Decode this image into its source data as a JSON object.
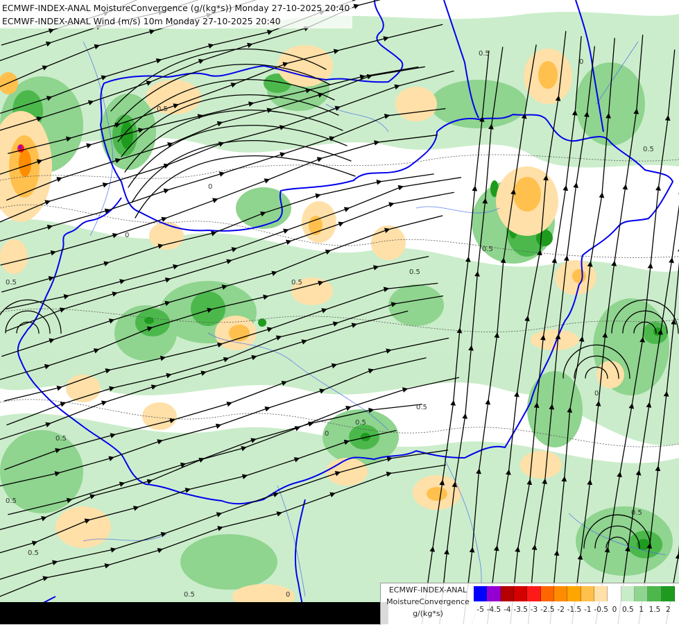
{
  "title": {
    "line1": "ECMWF-INDEX-ANAL MoistureConvergence (g/(kg*s)) Monday 27-10-2025 20:40",
    "line2": "ECMWF-INDEX-ANAL Wind (m/s) 10m Monday 27-10-2025 20:40"
  },
  "legend": {
    "line1": "ECMWF-INDEX-ANAL",
    "line2": "MoistureConvergence",
    "line3": "g/(kg*s)",
    "ticks": [
      "-5",
      "-4.5",
      "-4",
      "-3.5",
      "-3",
      "-2.5",
      "-2",
      "-1.5",
      "-1",
      "-0.5",
      "0",
      "0.5",
      "1",
      "1.5",
      "2"
    ],
    "colors": [
      "#0000ff",
      "#9400d3",
      "#b40000",
      "#d40000",
      "#ff1a1a",
      "#ff6600",
      "#ff8c00",
      "#ffa500",
      "#ffc04d",
      "#ffe0a8",
      "#ffffff",
      "#c8ecc8",
      "#8fd48f",
      "#4cb84c",
      "#1e9b1e"
    ]
  },
  "contour_labels": [
    "0.5",
    "0",
    "0.5",
    "0.5",
    "0",
    "0.5",
    "0.5",
    "0.5",
    "0",
    "0.5",
    "0.5",
    "0.5",
    "0",
    "0.5",
    "0.5",
    "0.5",
    "0",
    "0.5",
    "0.5",
    "0"
  ],
  "colors": {
    "border": "#0000ee",
    "river": "#4a6cf0",
    "streamline": "#000000",
    "green_light": "#c8ecc8",
    "green_mid": "#8fd48f",
    "green_dark": "#4cb84c",
    "orange_light": "#ffe0a8",
    "orange_mid": "#ffc04d"
  }
}
